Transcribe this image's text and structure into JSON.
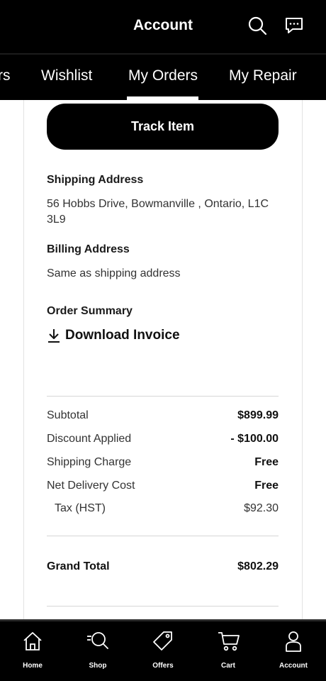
{
  "header": {
    "title": "Account"
  },
  "tabs": [
    {
      "label": "rs"
    },
    {
      "label": "Wishlist"
    },
    {
      "label": "My Orders"
    },
    {
      "label": "My Repair"
    }
  ],
  "track_button": "Track Item",
  "shipping": {
    "title": "Shipping Address",
    "line1": "56 Hobbs Drive, Bowmanville , Ontario, L1C",
    "line2": "3L9"
  },
  "billing": {
    "title": "Billing Address",
    "text": "Same as shipping address"
  },
  "order_summary": {
    "title": "Order Summary",
    "download_label": "Download Invoice"
  },
  "summary_rows": [
    {
      "label": "Subtotal",
      "value": "$899.99"
    },
    {
      "label": "Discount Applied",
      "value": "- $100.00"
    },
    {
      "label": "Shipping Charge",
      "value": "Free"
    },
    {
      "label": "Net Delivery Cost",
      "value": "Free"
    },
    {
      "label": "Tax (HST)",
      "value": "$92.30"
    }
  ],
  "grand_total": {
    "label": "Grand Total",
    "value": "$802.29"
  },
  "bottom_nav": [
    {
      "label": "Home",
      "icon": "home-icon"
    },
    {
      "label": "Shop",
      "icon": "shop-search-icon"
    },
    {
      "label": "Offers",
      "icon": "tag-icon"
    },
    {
      "label": "Cart",
      "icon": "cart-icon"
    },
    {
      "label": "Account",
      "icon": "person-icon"
    }
  ]
}
